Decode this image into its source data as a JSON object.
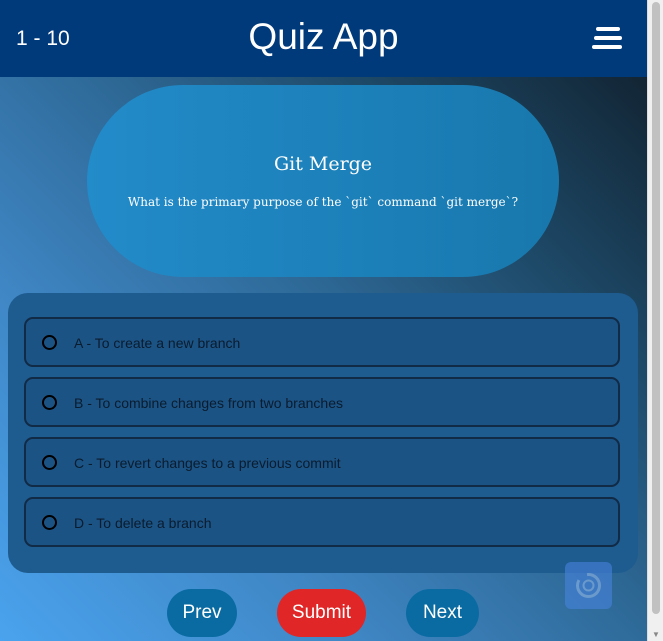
{
  "header": {
    "counter": "1 - 10",
    "title": "Quiz App",
    "menu_icon": "hamburger-menu-icon"
  },
  "question": {
    "title": "Git Merge",
    "text": "What is the primary purpose of the `git` command `git merge`?"
  },
  "options": [
    {
      "label": "A - To create a new branch"
    },
    {
      "label": "B - To combine changes from two branches"
    },
    {
      "label": "C - To revert changes to a previous commit"
    },
    {
      "label": "D - To delete a branch"
    }
  ],
  "buttons": {
    "prev": "Prev",
    "submit": "Submit",
    "next": "Next"
  },
  "colors": {
    "header": "#003a7a",
    "question_card": "#228bc9",
    "options_panel": "#1e5b8f",
    "submit": "#e02626",
    "nav_buttons": "#0a6ba2"
  }
}
